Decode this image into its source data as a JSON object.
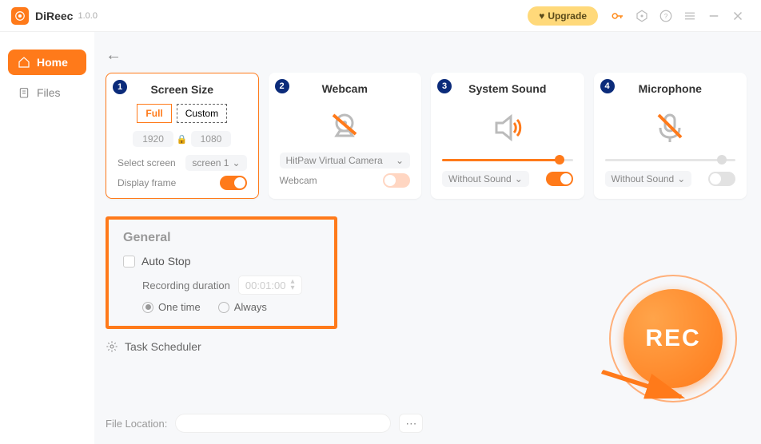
{
  "app": {
    "name": "DiReec",
    "version": "1.0.0",
    "upgrade": "Upgrade"
  },
  "sidebar": {
    "home": "Home",
    "files": "Files"
  },
  "cards": {
    "screen": {
      "title": "Screen Size",
      "full": "Full",
      "custom": "Custom",
      "width": "1920",
      "height": "1080",
      "select_screen_label": "Select screen",
      "screen_value": "screen 1",
      "display_frame_label": "Display frame"
    },
    "webcam": {
      "title": "Webcam",
      "device": "HitPaw Virtual Camera",
      "label": "Webcam"
    },
    "system_sound": {
      "title": "System Sound",
      "value": "Without Sound"
    },
    "microphone": {
      "title": "Microphone",
      "value": "Without Sound"
    }
  },
  "general": {
    "title": "General",
    "auto_stop": "Auto Stop",
    "duration_label": "Recording duration",
    "duration_value": "00:01:00",
    "one_time": "One time",
    "always": "Always"
  },
  "task_scheduler": "Task Scheduler",
  "file_location_label": "File Location:",
  "rec": "REC"
}
